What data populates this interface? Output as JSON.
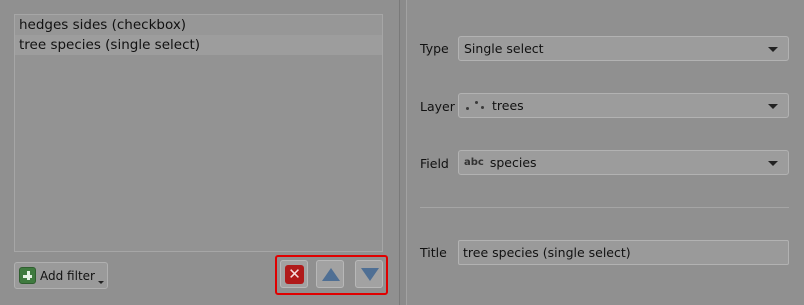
{
  "filters": {
    "items": [
      {
        "label": "hedges sides (checkbox)"
      },
      {
        "label": "tree species (single select)"
      }
    ]
  },
  "toolbar": {
    "add_filter_label": "Add filter"
  },
  "form": {
    "type_label": "Type",
    "type_value": "Single select",
    "layer_label": "Layer",
    "layer_value": "trees",
    "field_label": "Field",
    "field_value": "species",
    "field_type_badge": "abc",
    "title_label": "Title",
    "title_value": "tree species (single select)"
  },
  "colors": {
    "highlight_box": "#e00000",
    "remove_icon": "#b01a1a",
    "arrow_icon": "#4f6f94",
    "add_icon": "#3f7a3f"
  }
}
